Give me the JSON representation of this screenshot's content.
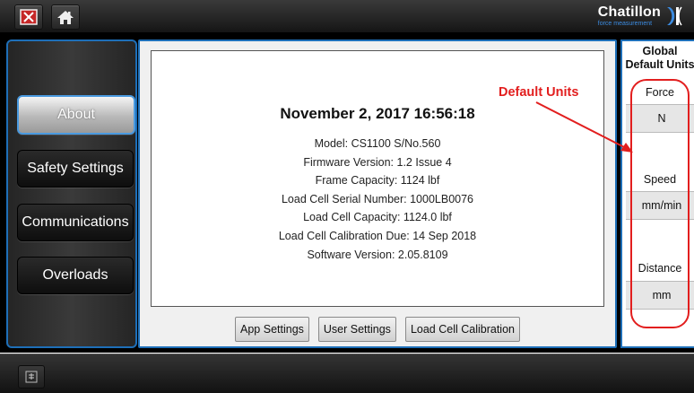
{
  "topbar": {
    "close_icon": "close-icon",
    "home_icon": "home-icon",
    "brand_name": "Chatillon",
    "brand_tagline": "force measurement"
  },
  "sidebar": {
    "items": [
      {
        "label": "About",
        "active": true
      },
      {
        "label": "Safety Settings",
        "active": false
      },
      {
        "label": "Communications",
        "active": false
      },
      {
        "label": "Overloads",
        "active": false
      }
    ]
  },
  "about": {
    "datetime": "November 2, 2017 16:56:18",
    "lines": [
      "Model: CS1100  S/No.560",
      "Firmware Version: 1.2 Issue 4",
      "Frame Capacity: 1124 lbf",
      "Load Cell Serial Number: 1000LB0076",
      "Load Cell Capacity: 1124.0 lbf",
      "Load Cell Calibration Due: 14 Sep 2018",
      "Software Version: 2.05.8109"
    ],
    "buttons": {
      "app_settings": "App Settings",
      "user_settings": "User Settings",
      "load_cell_calibration": "Load Cell Calibration"
    }
  },
  "units_panel": {
    "title_line1": "Global",
    "title_line2": "Default Units",
    "force_label": "Force",
    "force_value": "N",
    "speed_label": "Speed",
    "speed_value": "mm/min",
    "distance_label": "Distance",
    "distance_value": "mm"
  },
  "annotation": {
    "text": "Default Units",
    "color": "#e21e1e"
  },
  "bottombar": {
    "menu_icon": "menu-icon"
  },
  "colors": {
    "accent": "#1e6fb8",
    "brand_blue": "#3b8be0"
  }
}
